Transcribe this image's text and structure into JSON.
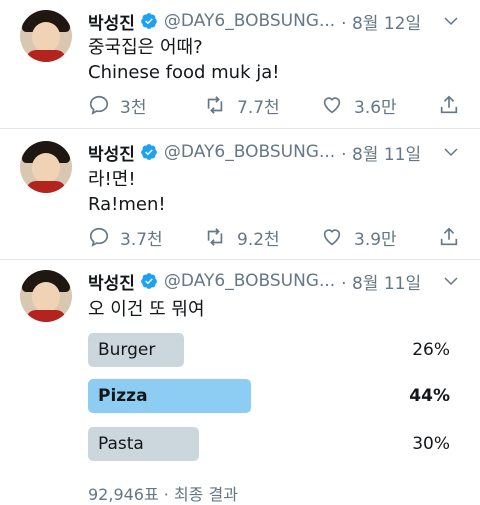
{
  "colors": {
    "accent": "#1da1f2",
    "muted": "#657786",
    "poll_winner": "#8ecdf3",
    "poll_other": "#ccd6dd"
  },
  "tweets": [
    {
      "name": "박성진",
      "handle": "@DAY6_BOBSUNG...",
      "date": "· 8월 12일",
      "lines": [
        "중국집은 어때?",
        "Chinese food muk ja!"
      ],
      "replies": "3천",
      "retweets": "7.7천",
      "likes": "3.6만"
    },
    {
      "name": "박성진",
      "handle": "@DAY6_BOBSUNG...",
      "date": "· 8월 11일",
      "lines": [
        "라!면!",
        "Ra!men!"
      ],
      "replies": "3.7천",
      "retweets": "9.2천",
      "likes": "3.9만"
    },
    {
      "name": "박성진",
      "handle": "@DAY6_BOBSUNG...",
      "date": "· 8월 11일",
      "lines": [
        "오 이건 또 뭐여"
      ],
      "poll": {
        "options": [
          {
            "label": "Burger",
            "percent": "26%",
            "value": 26,
            "winner": false
          },
          {
            "label": "Pizza",
            "percent": "44%",
            "value": 44,
            "winner": true
          },
          {
            "label": "Pasta",
            "percent": "30%",
            "value": 30,
            "winner": false
          }
        ],
        "footer": "92,946표 · 최종 결과"
      }
    }
  ]
}
